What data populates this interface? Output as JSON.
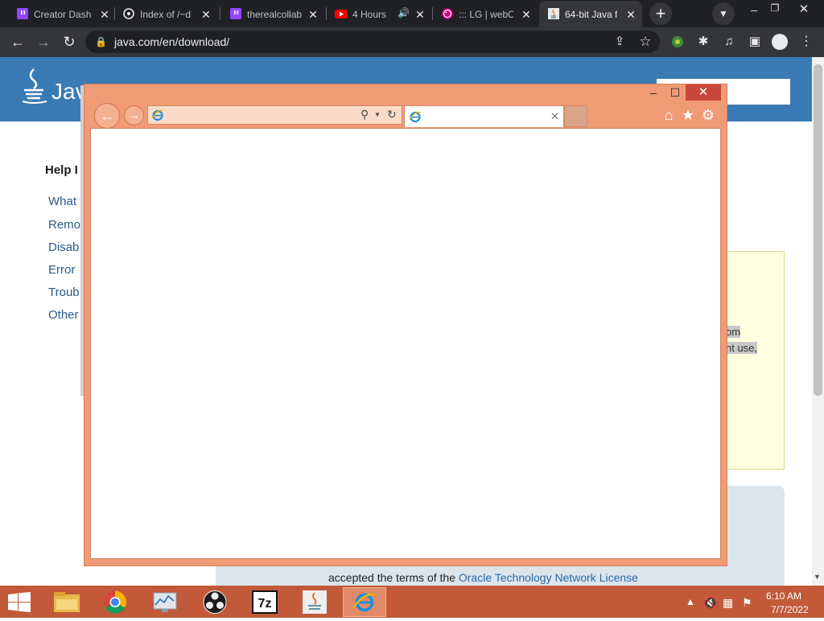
{
  "browser": {
    "tabs": [
      {
        "title": "Creator Dash",
        "favicon": "twitch-icon",
        "active": false
      },
      {
        "title": "Index of /~d",
        "favicon": "server-icon",
        "active": false
      },
      {
        "title": "therealcollab",
        "favicon": "twitch-icon",
        "active": false
      },
      {
        "title": "4 Hours",
        "favicon": "youtube-icon",
        "active": false
      },
      {
        "title": "::: LG | webO",
        "favicon": "lg-icon",
        "active": false
      },
      {
        "title": "64-bit Java f",
        "favicon": "java-icon",
        "active": true
      }
    ],
    "url": "java.com/en/download/",
    "colors": {
      "tab_strip": "#202124",
      "toolbar": "#35363a"
    }
  },
  "java_page": {
    "logo_text": "Java",
    "help_heading": "Help I",
    "help_links": [
      "What",
      "Remo",
      "Disab",
      "Error",
      "Troub",
      "Other"
    ],
    "highlighted_fragments": [
      "om",
      "nt use,"
    ],
    "license_prefix": "accepted the terms of the ",
    "license_link": "Oracle Technology Network License",
    "colors": {
      "header": "#3a7ab5",
      "link": "#2b5a8a"
    }
  },
  "ie_window": {
    "address_value": "",
    "tab_title": "",
    "buttons": {
      "minimize": "–",
      "maximize": "☐",
      "close": "✕"
    },
    "colors": {
      "frame": "#f09a76",
      "close": "#c8473a"
    }
  },
  "taskbar": {
    "pinned": [
      "file-explorer-icon",
      "chrome-icon",
      "performance-monitor-icon",
      "obs-icon",
      "7zip-icon",
      "java-icon",
      "internet-explorer-icon"
    ],
    "clock_time": "6:10 AM",
    "clock_date": "7/7/2022",
    "colors": {
      "background": "#c25a3a"
    }
  }
}
